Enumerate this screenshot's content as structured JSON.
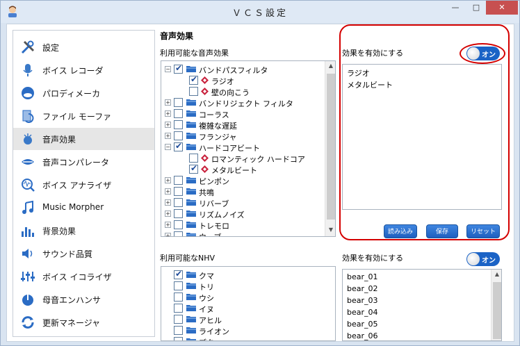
{
  "window": {
    "title": "ＶＣＳ設定",
    "minimize": "—",
    "maximize": "□",
    "close": "✕"
  },
  "sidebar": {
    "items": [
      {
        "label": "設定",
        "icon": "tools-icon"
      },
      {
        "label": "ボイス レコーダ",
        "icon": "microphone-icon"
      },
      {
        "label": "パロディメーカ",
        "icon": "mask-icon"
      },
      {
        "label": "ファイル モーファ",
        "icon": "file-morph-icon"
      },
      {
        "label": "音声効果",
        "icon": "sound-effect-icon"
      },
      {
        "label": "音声コンパレータ",
        "icon": "lips-icon"
      },
      {
        "label": "ボイス アナライザ",
        "icon": "analyzer-icon"
      },
      {
        "label": "Music Morpher",
        "icon": "music-note-icon"
      },
      {
        "label": "背景効果",
        "icon": "equalizer-bars-icon"
      },
      {
        "label": "サウンド品質",
        "icon": "speaker-icon"
      },
      {
        "label": "ボイス イコライザ",
        "icon": "equalizer-icon"
      },
      {
        "label": "母音エンハンサ",
        "icon": "vowel-icon"
      },
      {
        "label": "更新マネージャ",
        "icon": "update-icon"
      }
    ],
    "active_index": 4
  },
  "main": {
    "title": "音声効果",
    "effects_panel_label": "利用可能な音声効果",
    "effects_tree": [
      {
        "level": 0,
        "toggle": "⊟",
        "checked": true,
        "type": "folder",
        "label": "バンドパスフィルタ"
      },
      {
        "level": 1,
        "toggle": "",
        "checked": true,
        "type": "effect",
        "label": "ラジオ"
      },
      {
        "level": 1,
        "toggle": "",
        "checked": false,
        "type": "effect",
        "label": "壁の向こう"
      },
      {
        "level": 0,
        "toggle": "⊞",
        "checked": false,
        "type": "folder",
        "label": "バンドリジェクト フィルタ"
      },
      {
        "level": 0,
        "toggle": "⊞",
        "checked": false,
        "type": "folder",
        "label": "コーラス"
      },
      {
        "level": 0,
        "toggle": "⊞",
        "checked": false,
        "type": "folder",
        "label": "複雑な遅延"
      },
      {
        "level": 0,
        "toggle": "⊞",
        "checked": false,
        "type": "folder",
        "label": "フランジャ"
      },
      {
        "level": 0,
        "toggle": "⊟",
        "checked": true,
        "type": "folder",
        "label": "ハードコアビート"
      },
      {
        "level": 1,
        "toggle": "",
        "checked": false,
        "type": "effect",
        "label": "ロマンティック ハードコア"
      },
      {
        "level": 1,
        "toggle": "",
        "checked": true,
        "type": "effect",
        "label": "メタルビート"
      },
      {
        "level": 0,
        "toggle": "⊞",
        "checked": false,
        "type": "folder",
        "label": "ピンポン"
      },
      {
        "level": 0,
        "toggle": "⊞",
        "checked": false,
        "type": "folder",
        "label": "共鳴"
      },
      {
        "level": 0,
        "toggle": "⊞",
        "checked": false,
        "type": "folder",
        "label": "リバーブ"
      },
      {
        "level": 0,
        "toggle": "⊞",
        "checked": false,
        "type": "folder",
        "label": "リズムノイズ"
      },
      {
        "level": 0,
        "toggle": "⊞",
        "checked": false,
        "type": "folder",
        "label": "トレモロ"
      },
      {
        "level": 0,
        "toggle": "⊞",
        "checked": false,
        "type": "folder",
        "label": "ウーブ"
      }
    ],
    "enable_effects_label": "効果を有効にする",
    "enable_effects_toggle": "オン",
    "enabled_effects": [
      "ラジオ",
      "メタルビート"
    ],
    "buttons": {
      "load": "読み込み",
      "save": "保存",
      "reset": "リセット"
    },
    "nhv_panel_label": "利用可能なNHV",
    "nhv_tree": [
      {
        "checked": true,
        "label": "クマ"
      },
      {
        "checked": false,
        "label": "トリ"
      },
      {
        "checked": false,
        "label": "ウシ"
      },
      {
        "checked": false,
        "label": "イヌ"
      },
      {
        "checked": false,
        "label": "アヒル"
      },
      {
        "checked": false,
        "label": "ライオン"
      },
      {
        "checked": false,
        "label": "ブタ"
      }
    ],
    "enable_nhv_label": "効果を有効にする",
    "enable_nhv_toggle": "オン",
    "enabled_nhv": [
      "bear_01",
      "bear_02",
      "bear_03",
      "bear_04",
      "bear_05",
      "bear_06"
    ]
  },
  "colors": {
    "accent": "#1b63c6",
    "highlight": "#d40000",
    "close": "#c75050"
  }
}
